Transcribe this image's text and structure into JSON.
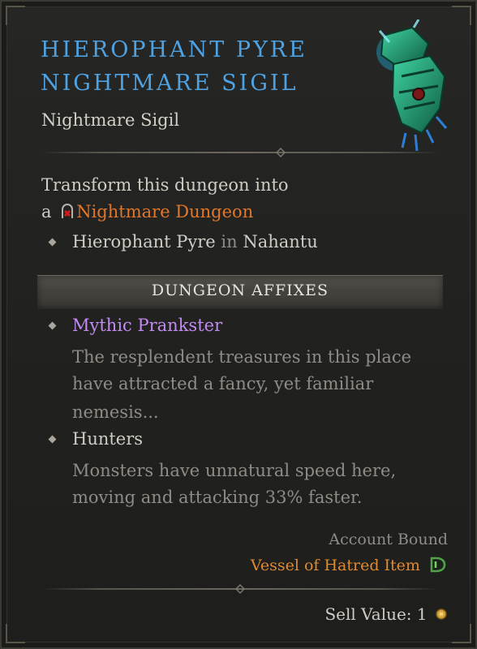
{
  "item": {
    "title_line1": "Hierophant Pyre",
    "title_line2": "Nightmare Sigil",
    "type": "Nightmare Sigil"
  },
  "transform": {
    "line1": "Transform this dungeon into",
    "line2_prefix": "a",
    "nightmare_label": "Nightmare Dungeon",
    "location_name": "Hierophant Pyre",
    "location_in": "in",
    "region": "Nahantu"
  },
  "affixes": {
    "header": "Dungeon Affixes",
    "items": [
      {
        "name": "Mythic Prankster",
        "description_lines": [
          "The resplendent treasures in this place",
          "have attracted a fancy, yet familiar",
          "nemesis..."
        ]
      },
      {
        "name": "Hunters",
        "description_lines": [
          "Monsters have unnatural speed here,",
          "moving and attacking 33% faster."
        ]
      }
    ]
  },
  "footer": {
    "binding": "Account Bound",
    "expansion": "Vessel of Hatred Item",
    "sell_label": "Sell Value:",
    "sell_value": "1"
  },
  "colors": {
    "title": "#4fa2e2",
    "nightmare": "#e0772b",
    "mythic": "#c28bf2",
    "vessel": "#e08a2f"
  },
  "icons": [
    "nightmare-dungeon-icon",
    "item-sigil-art",
    "vessel-of-hatred-icon",
    "gold-coin-icon",
    "divider-gem-icon",
    "bullet-diamond-icon"
  ]
}
